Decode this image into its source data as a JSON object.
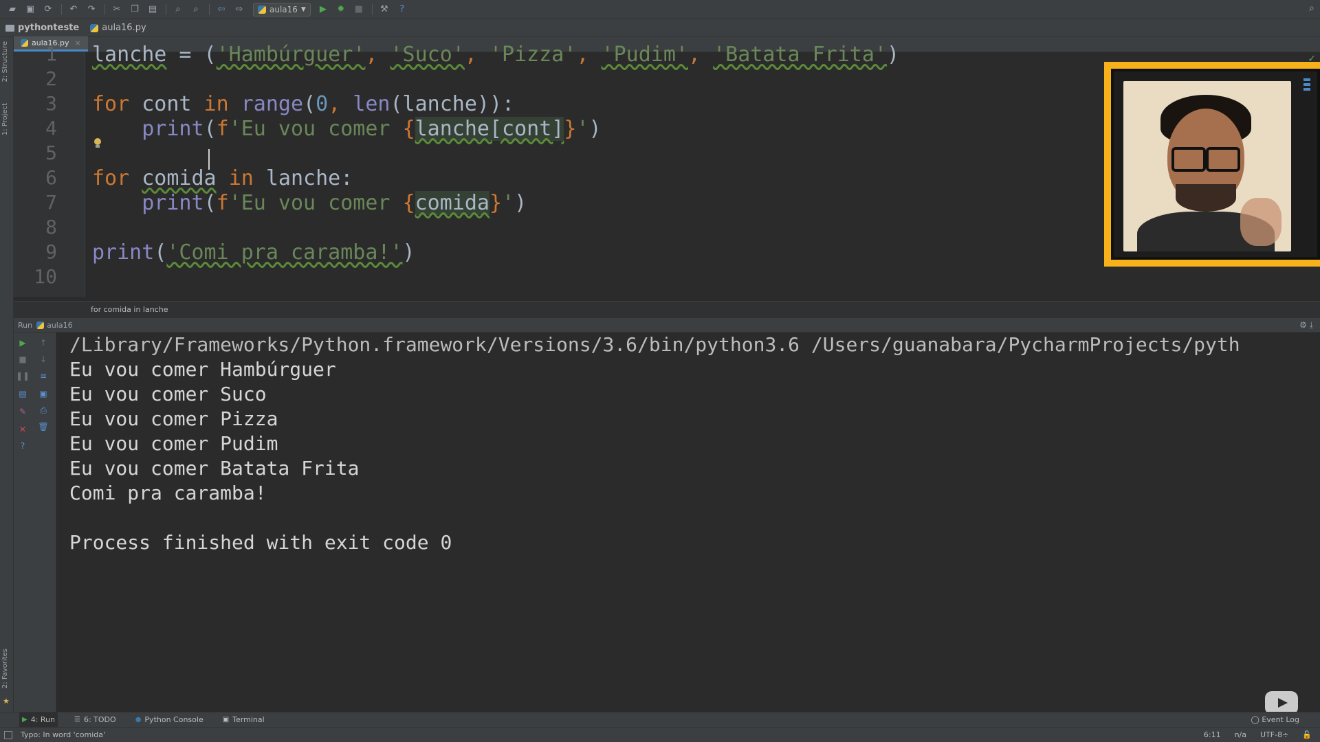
{
  "toolbar": {
    "run_config": "aula16",
    "icons": [
      "open-folder-icon",
      "save-icon",
      "sync-icon",
      "undo-icon",
      "redo-icon",
      "cut-icon",
      "copy-icon",
      "paste-icon",
      "find-icon",
      "replace-icon",
      "back-icon",
      "forward-icon",
      "run-icon",
      "debug-icon",
      "stop-icon",
      "build-icon",
      "help-icon",
      "search-icon"
    ]
  },
  "navbar": {
    "project": "pythonteste",
    "file": "aula16.py"
  },
  "left_stripe": {
    "structure": "2: Structure",
    "project": "1: Project",
    "favorites": "2: Favorites"
  },
  "editor": {
    "tab": "aula16.py",
    "line_numbers": [
      "1",
      "2",
      "3",
      "4",
      "5",
      "6",
      "7",
      "8",
      "9",
      "10"
    ],
    "lines": {
      "l1": {
        "a": "lanche",
        "b": " = (",
        "s1": "'Hambúrguer'",
        "c1": ", ",
        "s2": "'Suco'",
        "c2": ", ",
        "s3": "'Pizza'",
        "c3": ", ",
        "s4": "'Pudim'",
        "c4": ", ",
        "s5": "'Batata Frita'",
        "d": ")"
      },
      "l3": {
        "kw1": "for",
        "v": " cont ",
        "kw2": "in",
        "sp": " ",
        "fn": "range",
        "p1": "(",
        "n": "0",
        "p2": ", ",
        "fn2": "len",
        "p3": "(lanche)):"
      },
      "l4": {
        "ind": "    ",
        "fn": "print",
        "p": "(",
        "fp": "f",
        "s": "'Eu vou comer ",
        "b1": "{",
        "e": "lanche[cont]",
        "b2": "}",
        "s2": "'",
        "c": ")"
      },
      "l6": {
        "kw1": "for",
        "sp": " ",
        "v": "comida",
        "sp2": " ",
        "kw2": "in",
        "rest": " lanche:"
      },
      "l7": {
        "ind": "    ",
        "fn": "print",
        "p": "(",
        "fp": "f",
        "s": "'Eu vou comer ",
        "b1": "{",
        "e": "comida",
        "b2": "}",
        "s2": "'",
        "c": ")"
      },
      "l9": {
        "fn": "print",
        "p": "(",
        "s": "'Comi pra caramba!'",
        "c": ")"
      }
    },
    "breadcrumb": "for comida in lanche"
  },
  "run": {
    "label": "Run",
    "config": "aula16",
    "output": [
      "/Library/Frameworks/Python.framework/Versions/3.6/bin/python3.6 /Users/guanabara/PycharmProjects/pyth",
      "Eu vou comer Hambúrguer",
      "Eu vou comer Suco",
      "Eu vou comer Pizza",
      "Eu vou comer Pudim",
      "Eu vou comer Batata Frita",
      "Comi pra caramba!",
      "",
      "Process finished with exit code 0"
    ]
  },
  "bottom_tabs": {
    "run": "4: Run",
    "todo": "6: TODO",
    "console": "Python Console",
    "terminal": "Terminal",
    "event_log": "Event Log"
  },
  "status": {
    "message": "Typo: In word 'comida'",
    "position": "6:11",
    "na": "n/a",
    "encoding": "UTF-8÷"
  }
}
